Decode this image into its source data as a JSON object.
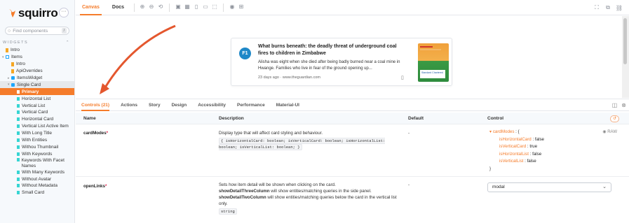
{
  "brand": {
    "name": "squirro",
    "more": "···"
  },
  "sidebar": {
    "search_placeholder": "Find components",
    "search_shortcut": "/",
    "section": "WIDGETS",
    "section_toggle": "⌃",
    "items": [
      {
        "label": "Intro",
        "icon": "doc",
        "indent": 0,
        "arrow": ""
      },
      {
        "label": "Items",
        "icon": "grid",
        "indent": 0,
        "arrow": "▾"
      },
      {
        "label": "Intro",
        "icon": "doc",
        "indent": 1,
        "arrow": ""
      },
      {
        "label": "ApiOverrides",
        "icon": "doc",
        "indent": 1,
        "arrow": ""
      },
      {
        "label": "ItemsWidget",
        "icon": "comp",
        "indent": 1,
        "arrow": "▸"
      },
      {
        "label": "Single Card",
        "icon": "comp",
        "indent": 1,
        "arrow": "▾",
        "state": "selected"
      },
      {
        "label": "Primary",
        "icon": "story",
        "indent": 2,
        "arrow": "",
        "state": "active"
      },
      {
        "label": "Horizontal List",
        "icon": "story",
        "indent": 2,
        "arrow": ""
      },
      {
        "label": "Vertical List",
        "icon": "story",
        "indent": 2,
        "arrow": ""
      },
      {
        "label": "Vertical Card",
        "icon": "story",
        "indent": 2,
        "arrow": ""
      },
      {
        "label": "Horizontal Card",
        "icon": "story",
        "indent": 2,
        "arrow": ""
      },
      {
        "label": "Vertical List Active Item",
        "icon": "story",
        "indent": 2,
        "arrow": ""
      },
      {
        "label": "With Long Title",
        "icon": "story",
        "indent": 2,
        "arrow": ""
      },
      {
        "label": "With Entities",
        "icon": "story",
        "indent": 2,
        "arrow": ""
      },
      {
        "label": "Withou Thumbnail",
        "icon": "story",
        "indent": 2,
        "arrow": ""
      },
      {
        "label": "With Keywords",
        "icon": "story",
        "indent": 2,
        "arrow": ""
      },
      {
        "label": "Keywords With Facet Names",
        "icon": "story",
        "indent": 2,
        "arrow": "",
        "multiline": true
      },
      {
        "label": "With Many Keywords",
        "icon": "story",
        "indent": 2,
        "arrow": ""
      },
      {
        "label": "Without Avatar",
        "icon": "story",
        "indent": 2,
        "arrow": ""
      },
      {
        "label": "Without Metadata",
        "icon": "story",
        "indent": 2,
        "arrow": ""
      },
      {
        "label": "Small Card",
        "icon": "story",
        "indent": 2,
        "arrow": ""
      }
    ]
  },
  "toolbar": {
    "tabs": [
      "Canvas",
      "Docs"
    ],
    "active_tab": "Canvas",
    "icons": [
      "zoom-in-icon",
      "zoom-out-icon",
      "zoom-reset-icon",
      "background-icon",
      "grid-icon",
      "viewport-icon",
      "measure-icon",
      "outline-icon",
      "accessibility-icon",
      "crosshair-icon"
    ],
    "icon_glyphs": [
      "⊕",
      "⊖",
      "⟲",
      "▣",
      "▦",
      "▯",
      "▭",
      "⬚",
      "◉",
      "⊞"
    ],
    "right_icons": [
      "⛶",
      "⧉",
      "⛓"
    ]
  },
  "card": {
    "avatar": "F1",
    "title": "What burns beneath: the deadly threat of underground coal fires to children in Zimbabwe",
    "body": "Alisha was eight when she died after being badly burned near a coal mine in Hwange. Families who live in fear of the ground opening up...",
    "meta": "23 days ago  ·  www.theguardian.com",
    "bookmark": "▯",
    "thumb_text": "Standard Chartered"
  },
  "panel": {
    "tabs": [
      "Controls (21)",
      "Actions",
      "Story",
      "Design",
      "Accessibility",
      "Performance",
      "Material-UI"
    ],
    "active_tab": "Controls (21)",
    "right_icons": [
      "◫",
      "⊗"
    ],
    "headers": {
      "name": "Name",
      "description": "Description",
      "default": "Default",
      "control": "Control"
    },
    "reset": "↺",
    "rows": [
      {
        "name": "cardModes",
        "required": "*",
        "description": "Display type that will affect card styling and behaviour.",
        "type": "{ isHorizontalCard: boolean; isVerticalCard: boolean; isHorizontalList: boolean; isVerticalList: boolean; }",
        "default": "-",
        "control_key": "cardModes",
        "control_open": "{",
        "control_close": "}",
        "raw_label": "RAW",
        "fields": [
          {
            "key": "isHorizontalCard",
            "value": "false"
          },
          {
            "key": "isVerticalCard",
            "value": "true"
          },
          {
            "key": "isHorizontalList",
            "value": "false"
          },
          {
            "key": "isVerticalList",
            "value": "false"
          }
        ]
      },
      {
        "name": "openLinks",
        "required": "*",
        "description_1": "Sets how item detail will be shown when clicking on the card.",
        "bold_1": "showDetailThreeColumn",
        "text_1": " will show entities/matching queries in the side panel.",
        "bold_2": "showDetailTwoColumn",
        "text_2": " will show entities/matching queries below the card in the vertical list only.",
        "type": "string",
        "default": "-",
        "select_value": "modal"
      }
    ]
  },
  "colors": {
    "accent": "#f57c2b",
    "arrow": "#e4572e",
    "avatar": "#1e88c8"
  }
}
